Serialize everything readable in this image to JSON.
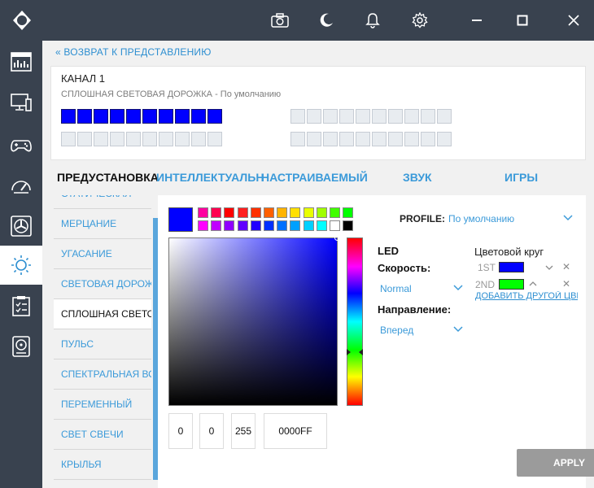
{
  "titlebar": {
    "icons": [
      "logo-icon",
      "camera-icon",
      "moon-icon",
      "bell-icon",
      "gear-icon",
      "minimize-icon",
      "maximize-icon",
      "close-icon"
    ]
  },
  "sidebar": {
    "items": [
      {
        "icon": "dashboard-icon",
        "active": false
      },
      {
        "icon": "monitor-icon",
        "active": false
      },
      {
        "icon": "gamepad-icon",
        "active": false
      },
      {
        "icon": "speedometer-icon",
        "active": false
      },
      {
        "icon": "fan-icon",
        "active": false
      },
      {
        "icon": "lighting-icon",
        "active": true
      },
      {
        "icon": "clipboard-icon",
        "active": false
      },
      {
        "icon": "storage-icon",
        "active": false
      }
    ]
  },
  "back_link": "« ВОЗВРАТ К ПРЕДСТАВЛЕНИЮ",
  "channel": {
    "title": "КАНАЛ 1",
    "subtitle": "СПЛОШНАЯ СВЕТОВАЯ ДОРОЖКА - По умолчанию",
    "led_on_color": "#0000ff",
    "led_groups_lit_count": [
      10,
      0,
      0,
      0
    ]
  },
  "tabs": [
    {
      "label": "ПРЕДУСТАНОВКА",
      "active": true
    },
    {
      "label": "ИНТЕЛЛЕКТУАЛЬНЫЙ",
      "active": false
    },
    {
      "label": "НАСТРАИВАЕМЫЙ",
      "active": false
    },
    {
      "label": "ЗВУК",
      "active": false
    },
    {
      "label": "ИГРЫ",
      "active": false
    }
  ],
  "presets": [
    {
      "label": "СТАТИЧЕСКАЯ",
      "selected": false
    },
    {
      "label": "МЕРЦАНИЕ",
      "selected": false
    },
    {
      "label": "УГАСАНИЕ",
      "selected": false
    },
    {
      "label": "СВЕТОВАЯ ДОРОЖКА",
      "selected": false
    },
    {
      "label": "СПЛОШНАЯ СВЕТОВАЯ ДОРОЖКА",
      "selected": true
    },
    {
      "label": "ПУЛЬС",
      "selected": false
    },
    {
      "label": "СПЕКТРАЛЬНАЯ ВОЛНА",
      "selected": false
    },
    {
      "label": "ПЕРЕМЕННЫЙ",
      "selected": false
    },
    {
      "label": "СВЕТ СВЕЧИ",
      "selected": false
    },
    {
      "label": "КРЫЛЬЯ",
      "selected": false
    }
  ],
  "palette": {
    "selected_color": "#0000ff",
    "row1": [
      "#ff00a0",
      "#ff0050",
      "#ff0000",
      "#ff2020",
      "#ff3000",
      "#ff6000",
      "#ffb400",
      "#ffe000",
      "#e8ff00",
      "#a0ff00",
      "#40ff00",
      "#00ff00"
    ],
    "row2": [
      "#ff00ff",
      "#c000ff",
      "#9000ff",
      "#6000ff",
      "#2000ff",
      "#0030ff",
      "#0070ff",
      "#00a0ff",
      "#00d0ff",
      "#00ffff",
      "#ffffff",
      "#000000"
    ]
  },
  "rgb": {
    "r": "0",
    "g": "0",
    "b": "255",
    "hex": "0000FF"
  },
  "profile": {
    "label": "PROFILE:",
    "value": "По умолчанию"
  },
  "led_settings": {
    "led_label": "LED",
    "speed_label": "Скорость:",
    "speed_value": "Normal",
    "direction_label": "Направление:",
    "direction_value": "Вперед"
  },
  "color_wheel": {
    "title": "Цветовой круг",
    "slots": [
      {
        "label": "1ST",
        "color": "#0000ff"
      },
      {
        "label": "2ND",
        "color": "#00ff00"
      }
    ],
    "add_link": "ДОБАВИТЬ ДРУГОЙ ЦВЕТ"
  },
  "apply_label": "APPLY"
}
